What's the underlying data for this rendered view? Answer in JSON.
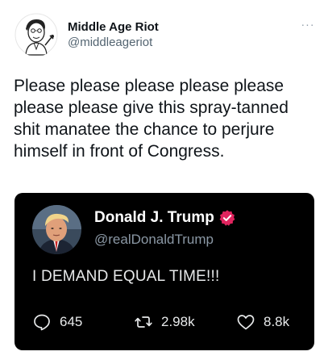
{
  "tweet": {
    "author_name": "Middle Age Riot",
    "author_handle": "@middleageriot",
    "more_label": "···",
    "text": "Please please please please please please please give this spray-tanned shit manatee the chance to perjure himself in front of Congress.",
    "avatar_icon": "cartoon-man-avatar"
  },
  "quoted": {
    "author_name": "Donald J. Trump",
    "author_handle": "@realDonaldTrump",
    "verified_icon": "verified-badge-icon",
    "verified_color": "#e0245e",
    "text": "I DEMAND EQUAL TIME!!!",
    "background": "#000000",
    "actions": {
      "replies": "645",
      "retweets": "2.98k",
      "likes": "8.8k"
    }
  }
}
